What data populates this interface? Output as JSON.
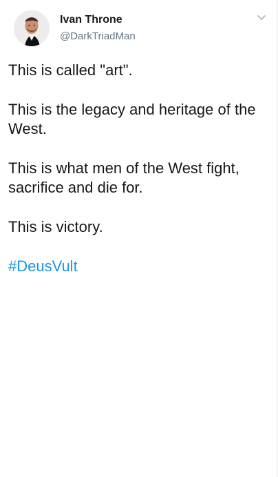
{
  "tweet": {
    "author": {
      "display_name": "Ivan Throne",
      "handle": "@DarkTriadMan"
    },
    "menu_icon": "chevron-down-icon",
    "text_lines": [
      "This is called \"art\".",
      "This is the legacy and heritage of the West.",
      "This is what men of the West fight, sacrifice and die for.",
      "This is victory."
    ],
    "hashtag": "#DeusVult",
    "colors": {
      "text": "#14171a",
      "secondary_text": "#657786",
      "link": "#1b95e0",
      "background": "#ffffff"
    }
  }
}
